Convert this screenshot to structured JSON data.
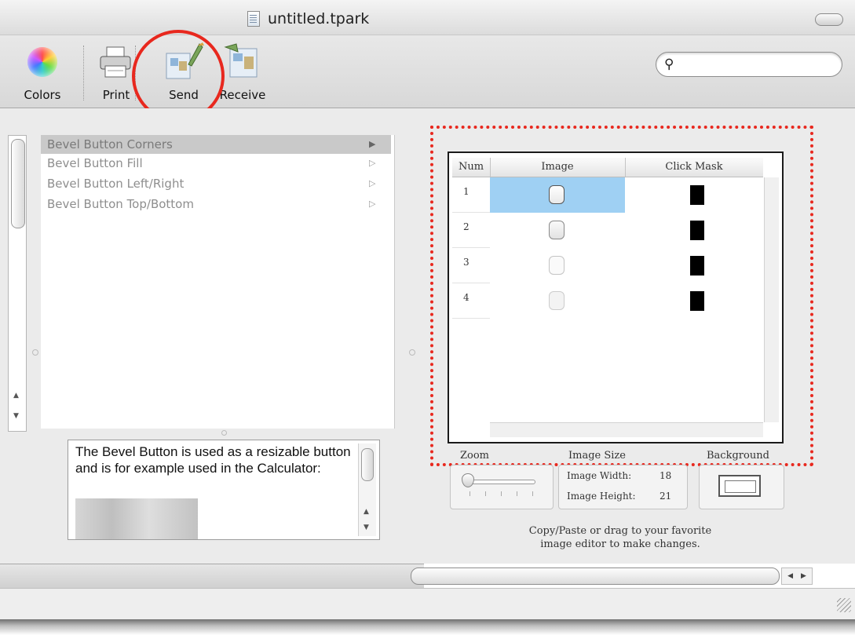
{
  "window": {
    "title": "untitled.tpark"
  },
  "toolbar": {
    "colors_label": "Colors",
    "print_label": "Print",
    "send_label": "Send",
    "receive_label": "Receive",
    "search_placeholder": ""
  },
  "part_list": [
    {
      "label": "Bevel Button Corners",
      "selected": true
    },
    {
      "label": "Bevel Button Fill",
      "selected": false
    },
    {
      "label": "Bevel Button Left/Right",
      "selected": false
    },
    {
      "label": "Bevel Button Top/Bottom",
      "selected": false
    }
  ],
  "description": {
    "text": "The Bevel Button is used as a resizable button and is for example used in the Calculator:"
  },
  "image_table": {
    "headers": {
      "num": "Num",
      "image": "Image",
      "click_mask": "Click Mask"
    },
    "rows": [
      {
        "num": "1",
        "selected": true
      },
      {
        "num": "2",
        "selected": false
      },
      {
        "num": "3",
        "selected": false
      },
      {
        "num": "4",
        "selected": false
      }
    ]
  },
  "controls": {
    "zoom_label": "Zoom",
    "image_size_label": "Image Size",
    "background_label": "Background",
    "image_width_label": "Image Width:",
    "image_width_value": "18",
    "image_height_label": "Image Height:",
    "image_height_value": "21",
    "hint_line1": "Copy/Paste or drag to your favorite",
    "hint_line2": "image editor to make changes."
  },
  "annotation_colors": {
    "highlight": "#e8281e",
    "selection": "#9fd0f3"
  }
}
